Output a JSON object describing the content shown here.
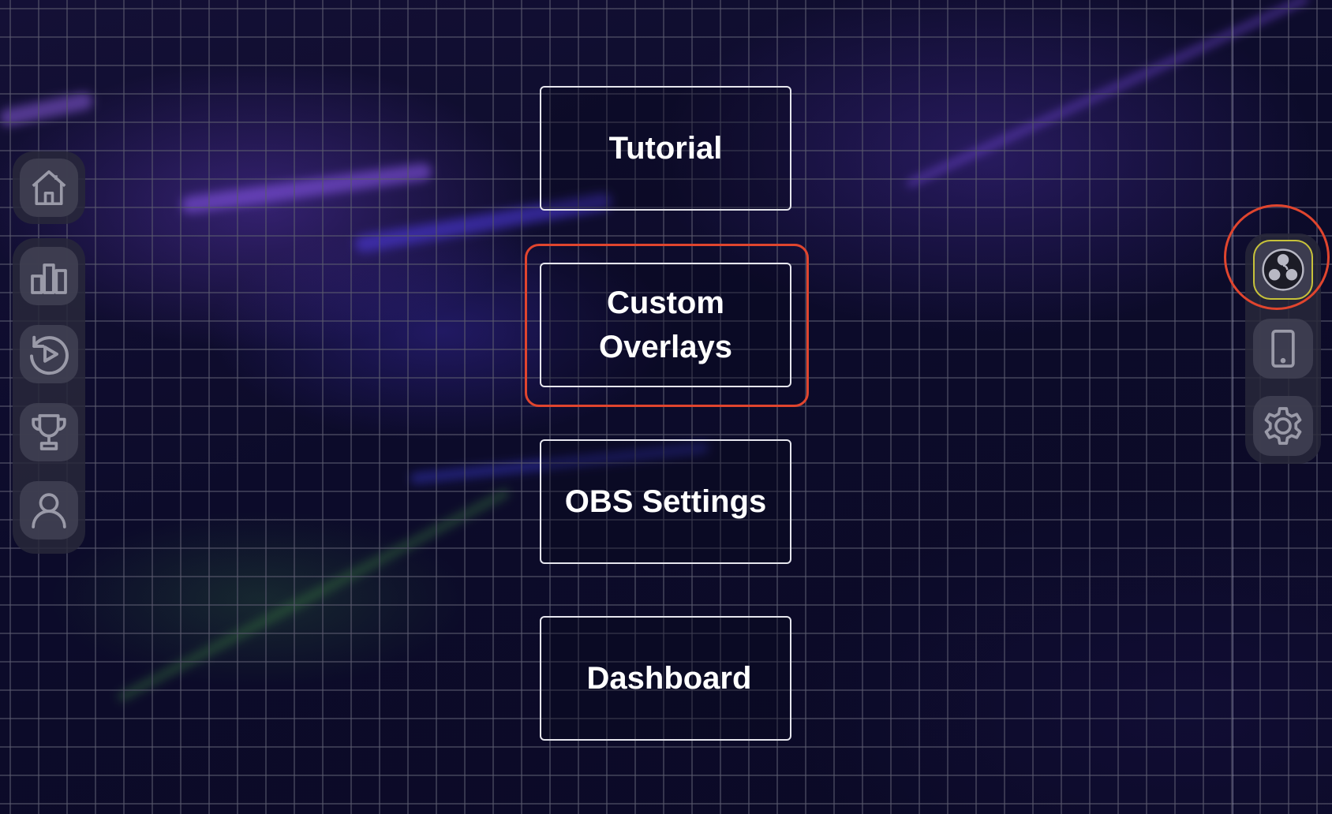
{
  "menu": {
    "tutorial_label": "Tutorial",
    "custom_overlays_label": "Custom Overlays",
    "obs_settings_label": "OBS Settings",
    "dashboard_label": "Dashboard"
  },
  "left_nav": {
    "items": [
      {
        "icon": "home-icon"
      },
      {
        "icon": "bar-chart-icon"
      },
      {
        "icon": "replay-icon"
      },
      {
        "icon": "trophy-icon"
      },
      {
        "icon": "user-icon"
      }
    ]
  },
  "right_nav": {
    "items": [
      {
        "icon": "obs-icon",
        "active": true
      },
      {
        "icon": "phone-icon"
      },
      {
        "icon": "gear-icon"
      }
    ]
  },
  "colors": {
    "highlight": "#e0452e",
    "active_outline": "#c7c23a",
    "icon": "#9a9aa8",
    "button_border": "#e6e6ee"
  }
}
